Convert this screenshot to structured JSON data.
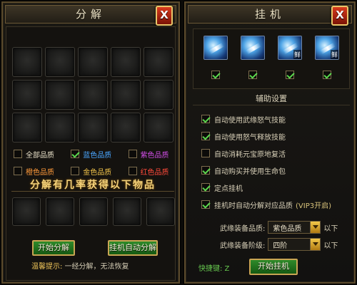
{
  "decompose": {
    "title": "分解",
    "filters": [
      [
        {
          "label": "全部品质",
          "checked": false,
          "color": "#e8e0c8"
        },
        {
          "label": "蓝色品质",
          "checked": true,
          "color": "#4aa6ff"
        },
        {
          "label": "紫色品质",
          "checked": false,
          "color": "#d04ee6"
        }
      ],
      [
        {
          "label": "橙色品质",
          "checked": false,
          "color": "#ff9a3a"
        },
        {
          "label": "金色品质",
          "checked": false,
          "color": "#f0c24a"
        },
        {
          "label": "红色品质",
          "checked": false,
          "color": "#ff4a3a"
        }
      ]
    ],
    "banner": "分解有几率获得以下物品",
    "decompose_button": "开始分解",
    "auto_decompose_button": "挂机自动分解",
    "tip_label": "温馨提示:",
    "tip_text": "一经分解，无法恢复"
  },
  "auto": {
    "title": "挂机",
    "skills": [
      {
        "icon": "skill-slash-icon",
        "tag": "",
        "checked": true
      },
      {
        "icon": "skill-wave-icon",
        "tag": "",
        "checked": true
      },
      {
        "icon": "skill-thrust-icon",
        "tag": "鲜",
        "checked": true
      },
      {
        "icon": "skill-strike-icon",
        "tag": "鲜",
        "checked": true
      }
    ],
    "assist_title": "辅助设置",
    "options": [
      {
        "label": "自动使用武缘怒气技能",
        "checked": true
      },
      {
        "label": "自动使用怒气释放技能",
        "checked": true
      },
      {
        "label": "自动消耗元宝原地复活",
        "checked": false
      },
      {
        "label": "自动购买并使用生命包",
        "checked": true
      },
      {
        "label": "定点挂机",
        "checked": true
      },
      {
        "label": "挂机时自动分解对应品质",
        "checked": true,
        "suffix": "(VIP3开启)"
      }
    ],
    "quality_label": "武缘装备品质:",
    "quality_value": "紫色品质",
    "quality_suffix": "以下",
    "tier_label": "武缘装备阶级:",
    "tier_value": "四阶",
    "tier_suffix": "以下",
    "hotkey": "快捷键: Z",
    "start_button": "开始挂机"
  }
}
